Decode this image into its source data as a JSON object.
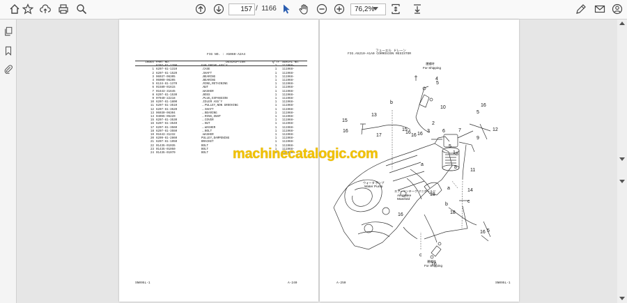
{
  "toolbar": {
    "page_current": "157",
    "page_separator": "/",
    "page_total": "1166",
    "zoom": "76,2%"
  },
  "left_page": {
    "fig_title": "FIG NO. : A5060-A2A4",
    "headers": [
      "INDEX",
      "PART NO.",
      "DESCRIPTION",
      "Q'TY",
      "SERIAL NO."
    ],
    "rows": [
      [
        "",
        "6207-61-1700",
        "FAN DRIVE ASS'Y",
        "1",
        "111968-"
      ],
      [
        "1",
        "6207-61-1310",
        ".CASE",
        "1",
        "111968-"
      ],
      [
        "2",
        "6207-61-1520",
        ".SHAFT",
        "1",
        "111968-"
      ],
      [
        "3",
        "06037-06305",
        ".BEARING",
        "1",
        "111968-"
      ],
      [
        "4",
        "06000-06205",
        ".BEARING",
        "1",
        "111968-"
      ],
      [
        "5",
        "6134-61-1370",
        ".RING,RETAINING",
        "1",
        "111968-"
      ],
      [
        "6",
        "01580-01615",
        ".NUT",
        "1",
        "111968-"
      ],
      [
        "7",
        "01643-31645",
        ".WASHER",
        "1",
        "111968-"
      ],
      [
        "8",
        "6207-61-1530",
        ".BOSS",
        "1",
        "111968-"
      ],
      [
        "9",
        "07040-22218",
        ".PLUG,EXPANSION",
        "1",
        "111968-"
      ],
      [
        "10",
        "6207-61-1800",
        ".IDLER ASS'Y",
        "1",
        "111968-"
      ],
      [
        "11",
        "6207-61-3510",
        "..PULLEY,NON GROOVING",
        "1",
        "111968-"
      ],
      [
        "12",
        "6207-61-3520",
        "..SHAFT",
        "1",
        "111968-"
      ],
      [
        "13",
        "06030-06304",
        "..BEARING",
        "1",
        "111968-"
      ],
      [
        "14",
        "04065-05220",
        "..RING,SNAP",
        "1",
        "111968-"
      ],
      [
        "15",
        "6207-61-3530",
        "..COVER",
        "1",
        "111968-"
      ],
      [
        "16",
        "6207-61-3540",
        "..NUT",
        "1",
        "111968-"
      ],
      [
        "17",
        "6207-61-3560",
        "..WASHER",
        "1",
        "111968-"
      ],
      [
        "18",
        "6207-61-3550",
        "..BOLT",
        "1",
        "111968-"
      ],
      [
        "19",
        "01643-31232",
        ".WASHER",
        "1",
        "111968-"
      ],
      [
        "20",
        "6209-61-2860",
        "PULLEY,DAMPENING",
        "1",
        "111968-"
      ],
      [
        "21",
        "6207-61-1950",
        "BRACKET",
        "1",
        "111968-"
      ],
      [
        "22",
        "01435-01035",
        "BOLT",
        "1",
        "111968-"
      ],
      [
        "23",
        "01435-01050",
        "BOLT",
        "1",
        "111968-"
      ],
      [
        "24",
        "01435-01070",
        "BOLT",
        "1",
        "111968-"
      ]
    ],
    "footer_left": "SN095L-1",
    "footer_right": "A-240"
  },
  "right_page": {
    "fig_title_jp": "フューエル ドレーン",
    "fig_title": "FIG.A5210-A1A0",
    "fig_subtitle": "CORROSION RESISTOR",
    "shipping_jp": "運搬時",
    "shipping_en": "For Shipping",
    "water_pump_jp": "ウォータ ポンプ",
    "water_pump_en": "Water Pump",
    "air_intake_jp": "エアーインテーク マニホールド",
    "air_intake_en1": "Air Intake",
    "air_intake_en2": "Manifold",
    "footer_left": "A-250",
    "footer_right": "SN095L-1",
    "callouts": [
      "1",
      "2",
      "3",
      "4",
      "5",
      "6",
      "7",
      "8",
      "9",
      "10",
      "11",
      "12",
      "13",
      "14",
      "15",
      "16",
      "17",
      "18"
    ],
    "ref_letters": [
      "a",
      "b",
      "c"
    ]
  },
  "watermark": "machinecatalogic.com"
}
